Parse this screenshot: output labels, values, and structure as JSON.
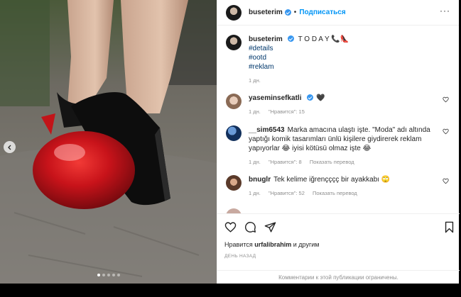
{
  "post": {
    "author": "buseterim",
    "follow_label": "Подписаться",
    "separator": "•",
    "caption_text": "T O D A Y 📞👠",
    "hashtags": [
      "#details",
      "#ootd",
      "#reklam"
    ],
    "caption_time": "1 дн."
  },
  "comments": [
    {
      "user": "yaseminsefkatli",
      "verified": true,
      "text": "🖤",
      "time": "1 дн.",
      "likes": "\"Нравится\": 15",
      "translate": ""
    },
    {
      "user": "__sim6543",
      "verified": false,
      "text": "Marka amacına ulaştı işte. \"Moda\" adı altında yaptığı komik tasarımları ünlü kişilere giydirerek reklam yapıyorlar 😂 iyisi kötüsü olmaz işte 😂",
      "time": "1 дн.",
      "likes": "\"Нравится\": 8",
      "translate": "Показать перевод"
    },
    {
      "user": "bnuglr",
      "verified": false,
      "text": "Tek kelime iğrençççç bir ayakkabı 🙄",
      "time": "1 дн.",
      "likes": "\"Нравится\": 52",
      "translate": "Показать перевод"
    }
  ],
  "footer": {
    "likes_prefix": "Нравится",
    "likes_user": "urfalibrahim",
    "likes_suffix": "и другим",
    "time_ago": "ДЕНЬ НАЗАД",
    "restricted": "Комментарии к этой публикации ограничены."
  },
  "carousel": {
    "total": 5,
    "active_index": 0
  },
  "colors": {
    "accent": "#0095f6",
    "verified": "#3897f0",
    "shoe_red": "#d0161a"
  },
  "icons": [
    "verified-badge-icon",
    "more-icon",
    "heart-icon",
    "comment-icon",
    "share-icon",
    "bookmark-icon",
    "chevron-left-icon"
  ]
}
